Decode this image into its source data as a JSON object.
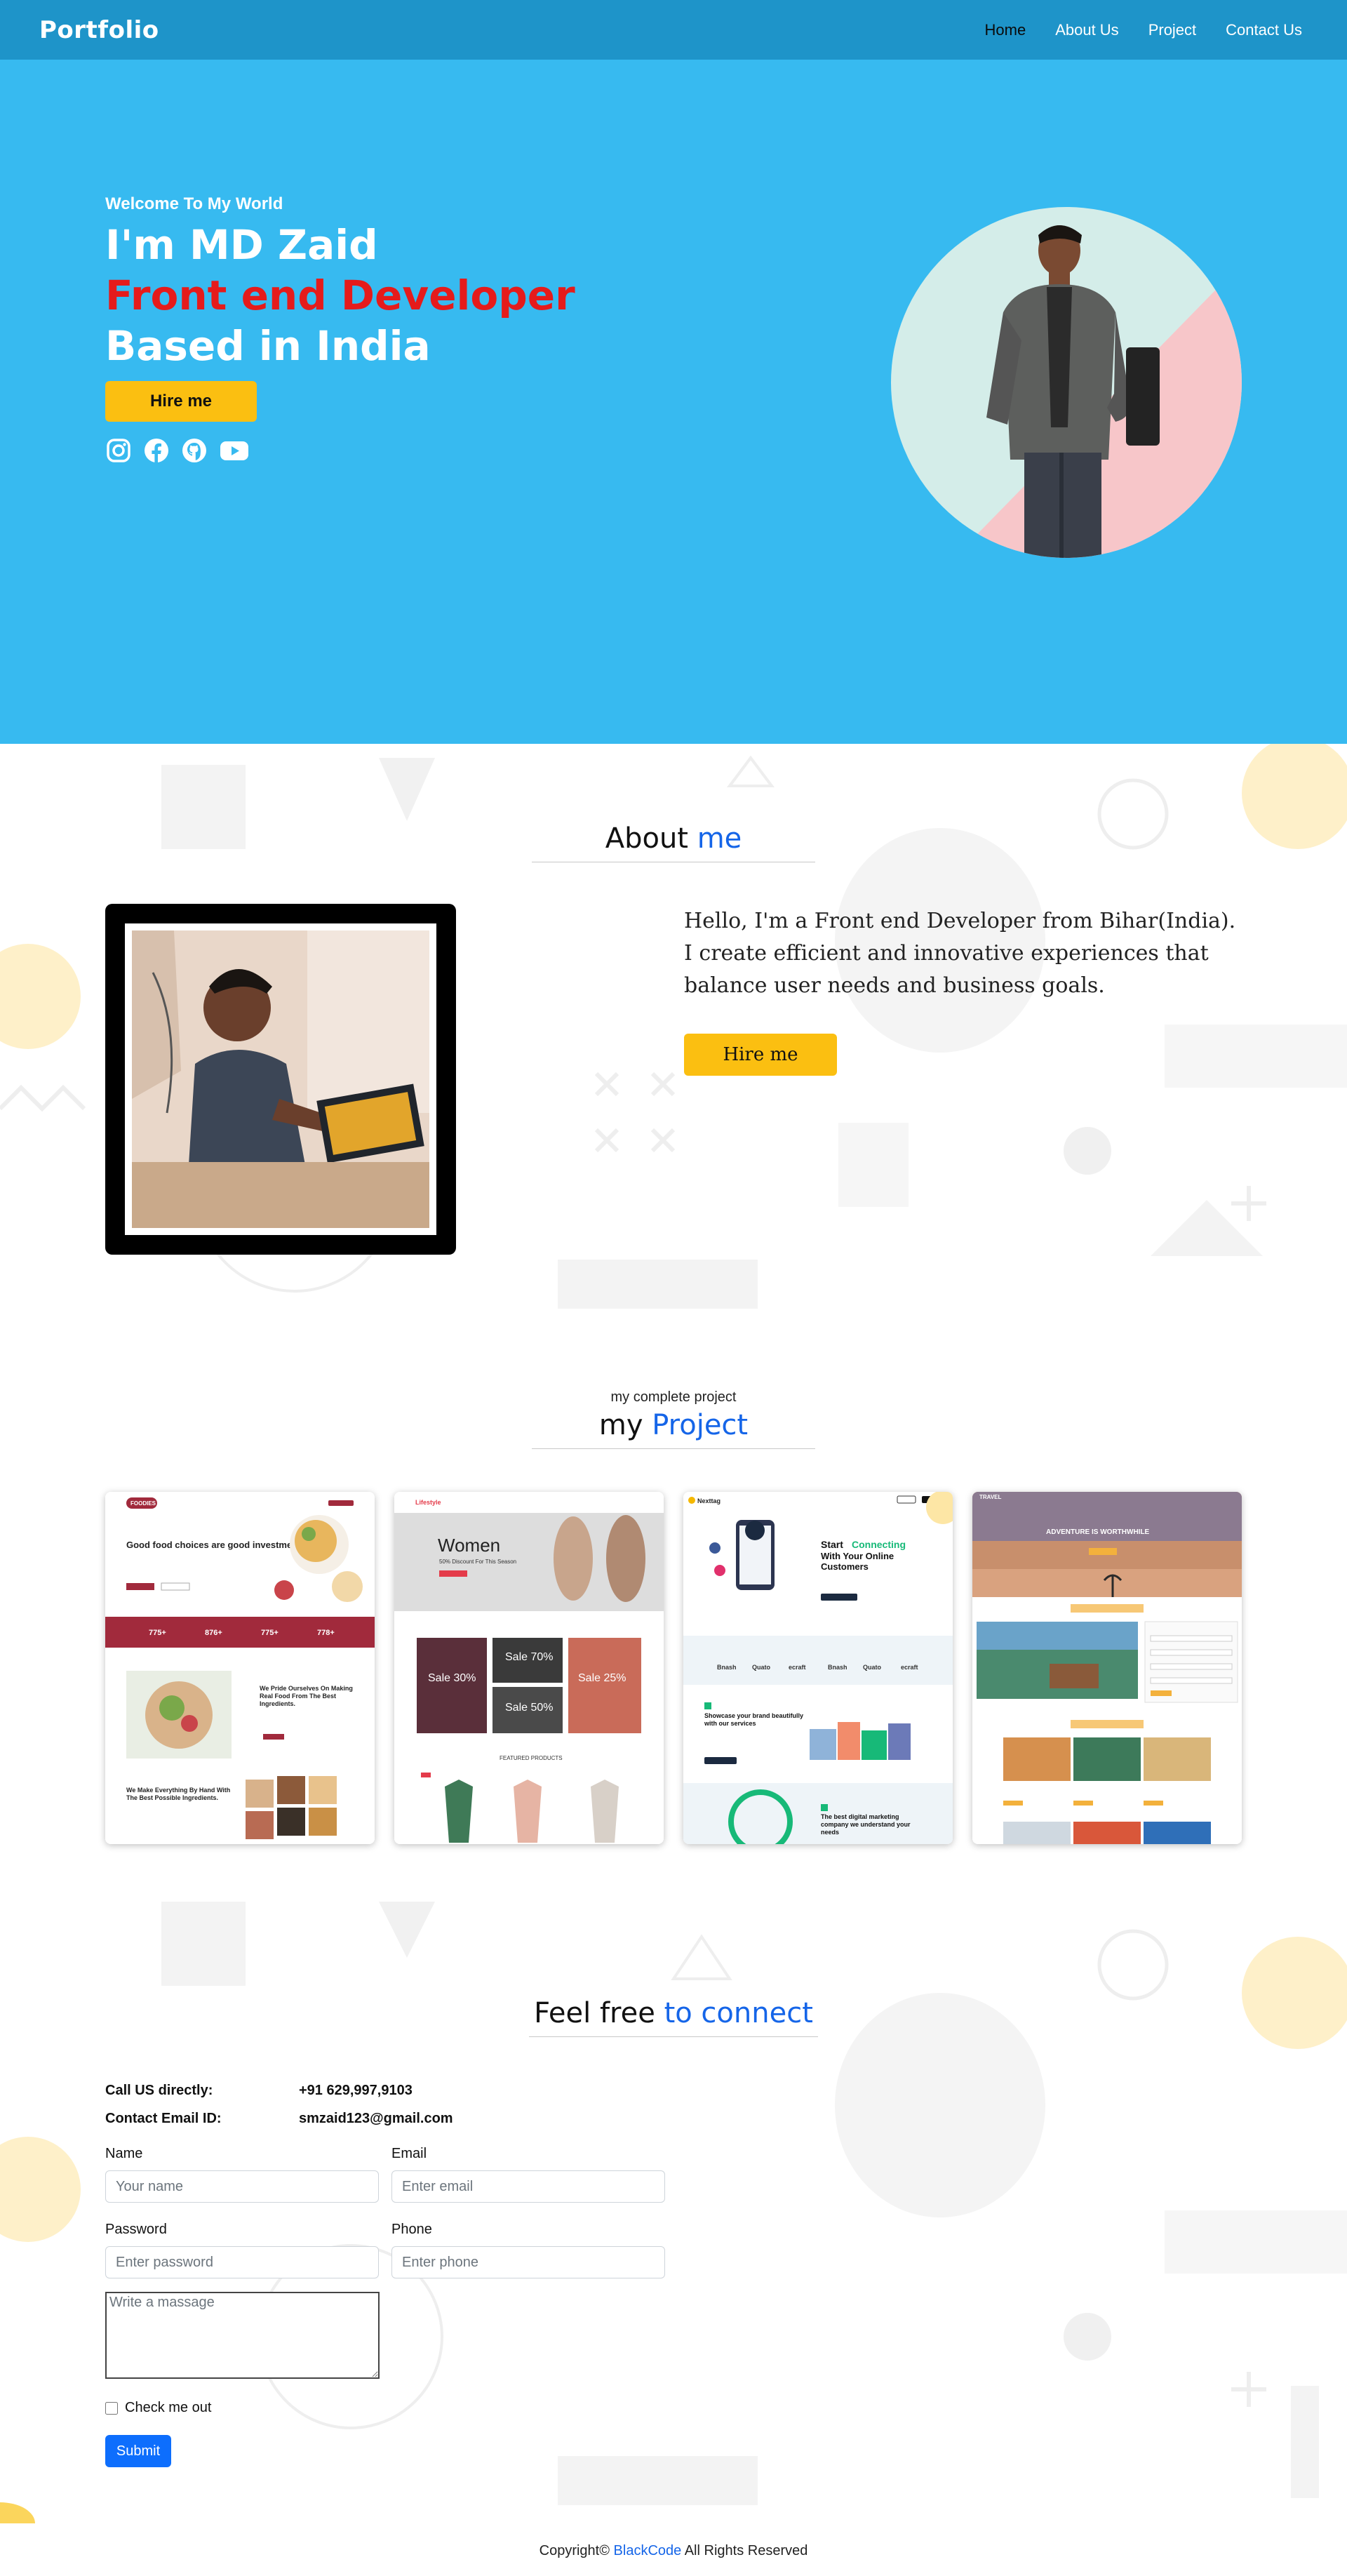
{
  "nav": {
    "brand": "Portfolio",
    "links": [
      "Home",
      "About Us",
      "Project",
      "Contact Us"
    ]
  },
  "hero": {
    "welcome": "Welcome To My World",
    "line1": "I'm MD Zaid",
    "line2": "Front end Developer",
    "line3": "Based in India",
    "hire_label": "Hire me",
    "social_icons": [
      "instagram-icon",
      "facebook-icon",
      "github-icon",
      "youtube-icon"
    ]
  },
  "about": {
    "title_plain": "About",
    "title_accent": "me",
    "paragraph": "Hello, I'm a Front end Developer from Bihar(India). I create efficient and innovative experiences that balance user needs and business goals.",
    "hire_label": "Hire me"
  },
  "projects": {
    "subtitle": "my complete project",
    "title_plain": "my",
    "title_accent": "Project",
    "cards": [
      {
        "brand": "FOODIES",
        "headline": "Good food choices are good investments.",
        "stats": [
          "775+",
          "876+",
          "775+",
          "778+"
        ],
        "feature1": "We Pride Ourselves On Making Real Food From The Best Ingredients.",
        "feature2": "We Make Everything By Hand With The Best Possible Ingredients."
      },
      {
        "brand": "Lifestyle",
        "headline": "Women",
        "subline": "50% Discount For This Season",
        "sales": [
          "Sale 30%",
          "Sale 70%",
          "Sale 50%",
          "Sale 25%"
        ],
        "featured": "FEATURED PRODUCTS"
      },
      {
        "brand": "Nexttag",
        "headline_a": "Start",
        "headline_b": "Connecting",
        "headline_c": "With Your Online Customers",
        "partners": [
          "Bnash",
          "Quato",
          "ecraft",
          "Bnash",
          "Quato",
          "ecraft"
        ],
        "feature1": "Showcase your brand beautifully with our services",
        "feature2": "The best digital marketing company we understand your needs"
      },
      {
        "brand": "TRAVEL",
        "headline": "ADVENTURE IS WORTHWHILE"
      }
    ]
  },
  "contact": {
    "title_plain": "Feel free",
    "title_accent": "to connect",
    "call_label": "Call US directly:",
    "call_value": "+91 629,997,9103",
    "email_label": "Contact Email ID:",
    "email_value": "smzaid123@gmail.com",
    "name_label": "Name",
    "name_placeholder": "Your name",
    "email_field_label": "Email",
    "email_placeholder": "Enter email",
    "password_label": "Password",
    "password_placeholder": "Enter password",
    "phone_label": "Phone",
    "phone_placeholder": "Enter phone",
    "message_placeholder": "Write a massage",
    "check_label": "Check me out",
    "submit_label": "Submit"
  },
  "footer": {
    "prefix": "Copyright©",
    "brand": "BlackCode",
    "suffix": "All Rights Reserved"
  },
  "colors": {
    "nav_bg": "#1e94c9",
    "hero_bg": "#37baf0",
    "accent_red": "#e51b1b",
    "button_yellow": "#fbbf11",
    "accent_blue": "#1565e8",
    "submit_blue": "#0d6efd"
  }
}
